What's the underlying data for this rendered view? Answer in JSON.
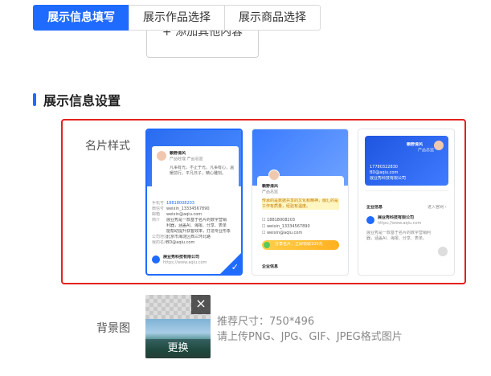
{
  "tabs": [
    {
      "label": "展示信息填写",
      "active": true
    },
    {
      "label": "展示作品选择",
      "active": false
    },
    {
      "label": "展示商品选择",
      "active": false
    }
  ],
  "add_button_label": "+ 添加其他内容",
  "section": {
    "title": "展示信息设置",
    "accent": "#1f6bff"
  },
  "card_style": {
    "label": "名片样式",
    "highlight_color": "#e3221c",
    "templates": [
      {
        "name": "赖野清风",
        "role": "产品经理  产品总监",
        "intro": "凡事有光，不止于光。凡事有心，温暖前行。平凡日子，精心雕刻。",
        "rows": [
          {
            "k": "手机号",
            "v": "18818008203"
          },
          {
            "k": "微信号",
            "v": "weixin_13334567890"
          },
          {
            "k": "邮箱",
            "v": "weixin@aqiu.com"
          },
          {
            "k": "简介",
            "v": "展业秀是一款基于名片的数字营销"
          },
          {
            "k": "",
            "v": "利器，涵盖AI、海报、分享、表单"
          },
          {
            "k": "",
            "v": "能帮助提升获客效率，打造专业形象"
          },
          {
            "k": "公司地址",
            "v": "北京市海淀区西三环北路"
          },
          {
            "k": "我的名片",
            "v": "BD@aqiu.com"
          }
        ],
        "company": "展业秀科技有限公司",
        "site": "https://www.aqiu.com",
        "selected": true
      },
      {
        "name": "赖野清风",
        "role": "产品总监",
        "quote": "传承的是数据共享的文化和精神，融汇的是工作有质量，经验有温度。",
        "contacts": [
          "18818008203",
          "weixin_13334567890",
          "weixin@aqiu.com"
        ],
        "promo": "分享名片，立即领取100元",
        "footer": "企业信息",
        "selected": false
      },
      {
        "name": "赖野清风",
        "role": "产品总监",
        "contacts": [
          "17780322830",
          "BD@aqiu.com",
          "展业秀科技有限公司"
        ],
        "section": "企业信息",
        "more": "进入官网 ›",
        "company": "展业秀科技有限公司",
        "site": "https://www.aqiu.com",
        "desc": "展业秀是一款基于名片的数字营销利器，涵盖AI、海报、分享、表单。",
        "selected": false
      }
    ]
  },
  "background": {
    "label": "背景图",
    "change_label": "更换",
    "close_icon": "×",
    "hint_size": "推荐尺寸：750*496",
    "hint_format": "请上传PNG、JPG、GIF、JPEG格式图片"
  }
}
